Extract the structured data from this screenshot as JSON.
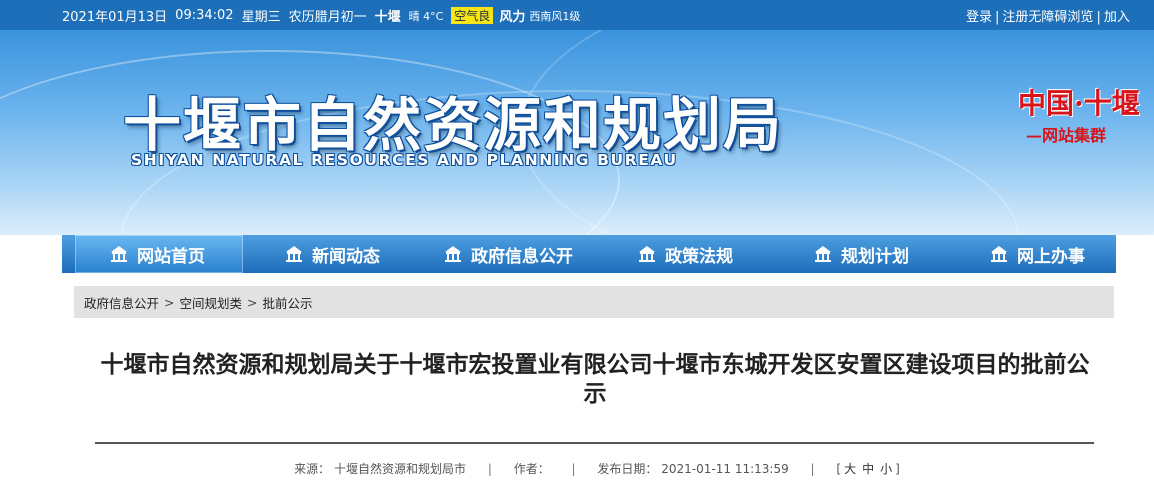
{
  "topbar": {
    "date": "2021年01月13日",
    "time": "09:34:02",
    "weekday": "星期三",
    "lunar": "农历腊月初一",
    "city": "十堰",
    "weather": "晴 4°C",
    "air_quality": "空气良",
    "wind_label": "风力",
    "wind": "西南风1级",
    "login": "登录",
    "register": "注册",
    "accessible": "无障碍浏览",
    "favorite": "加入"
  },
  "banner": {
    "title_cn": "十堰市自然资源和规划局",
    "title_en": "SHIYAN NATURAL RESOURCES AND PLANNING BUREAU",
    "group_line1": "中国·十堰",
    "group_line2": "—网站集群"
  },
  "nav": {
    "items": [
      {
        "label": "网站首页",
        "icon": "building-icon"
      },
      {
        "label": "新闻动态",
        "icon": "building-icon"
      },
      {
        "label": "政府信息公开",
        "icon": "building-icon"
      },
      {
        "label": "政策法规",
        "icon": "building-icon"
      },
      {
        "label": "规划计划",
        "icon": "building-icon"
      },
      {
        "label": "网上办事",
        "icon": "building-icon"
      }
    ]
  },
  "breadcrumb": {
    "items": [
      "政府信息公开",
      "空间规划类",
      "批前公示"
    ],
    "separator": ">"
  },
  "article": {
    "title": "十堰市自然资源和规划局关于十堰市宏投置业有限公司十堰市东城开发区安置区建设项目的批前公示",
    "source_label": "来源：",
    "source": "十堰自然资源和规划局市",
    "author_label": "作者：",
    "author": "",
    "date_label": "发布日期：",
    "date": "2021-01-11 11:13:59",
    "size_open": "[",
    "size_large": "大",
    "size_medium": "中",
    "size_small": "小",
    "size_close": "]"
  },
  "colors": {
    "topbar": "#1c6fb8",
    "nav": "#1d6dbb",
    "accent_red": "#d7141a",
    "air_quality_bg": "#f6e514"
  }
}
